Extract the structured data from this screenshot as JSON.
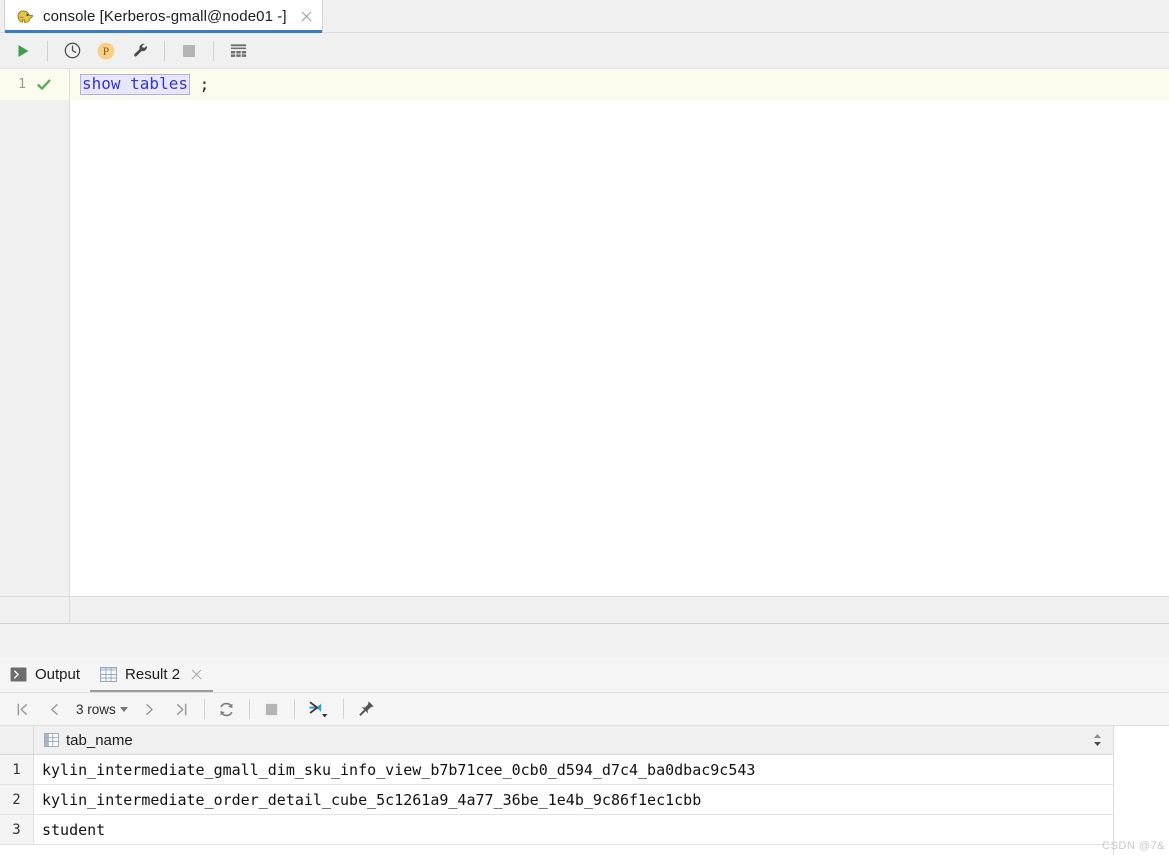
{
  "window": {
    "tab": {
      "icon": "elephant-icon",
      "title": "console [Kerberos-gmall@node01 -]",
      "close": "close-icon"
    }
  },
  "editor_toolbar": {
    "buttons": [
      {
        "name": "execute-button",
        "icon": "play-icon",
        "tooltip": "Execute"
      },
      {
        "name": "history-button",
        "icon": "clock-icon",
        "tooltip": "History"
      },
      {
        "name": "parameters-button",
        "icon": "p-circle-icon",
        "tooltip": "Parameters"
      },
      {
        "name": "settings-button",
        "icon": "wrench-icon",
        "tooltip": "Settings"
      },
      {
        "name": "stop-button",
        "icon": "stop-square-icon",
        "tooltip": "Stop"
      },
      {
        "name": "grid-view-button",
        "icon": "table-grid-icon",
        "tooltip": "Show results"
      }
    ]
  },
  "editor": {
    "line_number": "1",
    "status_icon": "green-check-icon",
    "code": {
      "keyword": "show tables",
      "punctuation": " ;"
    }
  },
  "bottom_tabs": [
    {
      "name": "tab-output",
      "icon": "console-output-icon",
      "label": "Output",
      "active": false,
      "closable": false
    },
    {
      "name": "tab-result-2",
      "icon": "table-grid-icon",
      "label": "Result 2",
      "active": true,
      "closable": true
    }
  ],
  "result_toolbar": {
    "first_page": "first-page-icon",
    "prev_page": "prev-page-icon",
    "rows_label": "3 rows",
    "rows_dropdown": "chevron-down-icon",
    "next_page": "next-page-icon",
    "last_page": "last-page-icon",
    "refresh": "refresh-icon",
    "stop": "stop-square-icon",
    "transpose": "fit-columns-icon",
    "pin": "pin-icon"
  },
  "grid": {
    "column_icon": "column-icon",
    "sort_icon": "sort-updown-icon",
    "columns": [
      "tab_name"
    ],
    "rows": [
      {
        "num": "1",
        "tab_name": "kylin_intermediate_gmall_dim_sku_info_view_b7b71cee_0cb0_d594_d7c4_ba0dbac9c543"
      },
      {
        "num": "2",
        "tab_name": "kylin_intermediate_order_detail_cube_5c1261a9_4a77_36be_1e4b_9c86f1ec1cbb"
      },
      {
        "num": "3",
        "tab_name": "student"
      }
    ]
  },
  "watermark": "CSDN @7&",
  "colors": {
    "tab_accent": "#3a7cc4",
    "keyword": "#3434cf",
    "selection_bg": "#e8e6fa",
    "current_line": "#fbfbee",
    "toolbar_bg": "#f0f0f0",
    "play_green": "#4caf50",
    "p_orange": "#f5c26b",
    "transpose_blue": "#3d9ad4"
  }
}
